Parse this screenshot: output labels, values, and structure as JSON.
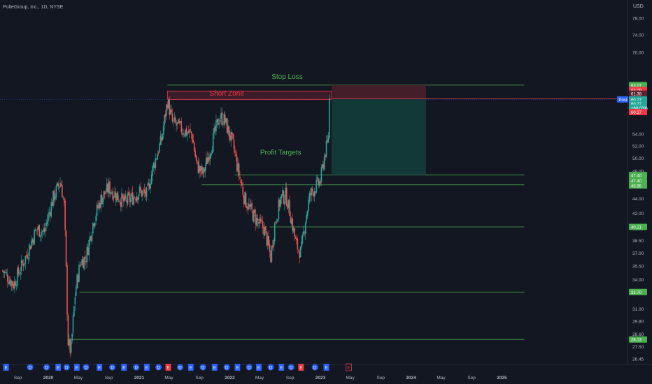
{
  "header": {
    "title": "PulteGroup, Inc., 1D, NYSE",
    "currency": "USD"
  },
  "colors": {
    "background": "#131722",
    "up": "#26a69a",
    "down": "#ef5350",
    "level_line": "#4caf50",
    "stop_line": "#4caf50",
    "short_zone_border": "#f23645",
    "short_zone_fill": "#5b2230",
    "target_fill": "#133a3a",
    "risk_fill": "#4a1f2a",
    "axis_text": "#b2b5be",
    "earnings_blue": "#2962ff",
    "earnings_red": "#f23645"
  },
  "chart_data": {
    "type": "candlestick",
    "title": "PulteGroup, Inc., 1D, NYSE",
    "y_axis": {
      "unit": "USD",
      "scale": "log",
      "ticks": [
        26.45,
        27.5,
        28.6,
        29.8,
        31.0,
        32.7,
        34.0,
        35.5,
        37.0,
        38.5,
        40.0,
        42.0,
        44.0,
        46.0,
        48.0,
        50.0,
        52.0,
        54.0,
        56.0,
        70.0,
        74.0,
        78.0
      ],
      "tick_labels": [
        "26.45",
        "27.50",
        "28.60",
        "29.80",
        "31.00",
        "",
        "34.00",
        "35.50",
        "37.00",
        "38.50",
        "40.00",
        "42.00",
        "44.00",
        "",
        "48.00",
        "50.00",
        "52.00",
        "54.00",
        "",
        "70.00",
        "74.00",
        "78.00"
      ]
    },
    "x_axis": {
      "tick_labels": [
        "Sep",
        "2020",
        "May",
        "Sep",
        "2021",
        "May",
        "Sep",
        "2022",
        "May",
        "Sep",
        "2023",
        "May",
        "Sep",
        "2024",
        "May",
        "Sep",
        "2025"
      ],
      "tick_dates": [
        "2019-09-01",
        "2020-01-01",
        "2020-05-01",
        "2020-09-01",
        "2021-01-01",
        "2021-05-01",
        "2021-09-01",
        "2022-01-01",
        "2022-05-01",
        "2022-09-01",
        "2023-01-01",
        "2023-05-01",
        "2023-09-01",
        "2024-01-01",
        "2024-05-01",
        "2024-09-01",
        "2025-01-01"
      ]
    },
    "price_path": [
      [
        "2019-07-01",
        35.0
      ],
      [
        "2019-08-15",
        33.5
      ],
      [
        "2019-10-01",
        36.5
      ],
      [
        "2019-11-15",
        40.0
      ],
      [
        "2019-12-15",
        39.5
      ],
      [
        "2020-01-20",
        44.0
      ],
      [
        "2020-02-20",
        46.5
      ],
      [
        "2020-03-05",
        43.0
      ],
      [
        "2020-03-20",
        28.0
      ],
      [
        "2020-04-01",
        27.0
      ],
      [
        "2020-04-20",
        33.0
      ],
      [
        "2020-05-10",
        36.0
      ],
      [
        "2020-06-01",
        36.5
      ],
      [
        "2020-07-01",
        41.0
      ],
      [
        "2020-08-01",
        44.0
      ],
      [
        "2020-09-01",
        45.5
      ],
      [
        "2020-10-01",
        44.5
      ],
      [
        "2020-11-01",
        43.5
      ],
      [
        "2020-12-01",
        44.0
      ],
      [
        "2021-01-01",
        45.0
      ],
      [
        "2021-02-01",
        44.5
      ],
      [
        "2021-03-01",
        49.0
      ],
      [
        "2021-04-01",
        53.0
      ],
      [
        "2021-04-25",
        60.0
      ],
      [
        "2021-05-15",
        56.0
      ],
      [
        "2021-06-01",
        55.5
      ],
      [
        "2021-07-01",
        54.5
      ],
      [
        "2021-08-01",
        54.0
      ],
      [
        "2021-08-20",
        49.0
      ],
      [
        "2021-09-15",
        47.5
      ],
      [
        "2021-10-15",
        51.5
      ],
      [
        "2021-11-20",
        57.0
      ],
      [
        "2021-12-10",
        56.5
      ],
      [
        "2022-01-15",
        52.0
      ],
      [
        "2022-02-01",
        48.5
      ],
      [
        "2022-03-01",
        44.0
      ],
      [
        "2022-04-01",
        42.0
      ],
      [
        "2022-05-01",
        40.5
      ],
      [
        "2022-05-20",
        40.0
      ],
      [
        "2022-06-15",
        36.5
      ],
      [
        "2022-07-01",
        40.5
      ],
      [
        "2022-07-25",
        44.0
      ],
      [
        "2022-08-15",
        44.5
      ],
      [
        "2022-09-01",
        42.0
      ],
      [
        "2022-09-25",
        38.0
      ],
      [
        "2022-10-15",
        37.0
      ],
      [
        "2022-11-01",
        41.0
      ],
      [
        "2022-11-20",
        44.5
      ],
      [
        "2022-12-10",
        45.5
      ],
      [
        "2023-01-01",
        46.5
      ],
      [
        "2023-01-20",
        51.0
      ],
      [
        "2023-02-01",
        52.5
      ],
      [
        "2023-02-06",
        60.27
      ]
    ],
    "last_price": 60.27,
    "price_labels": [
      {
        "text": "63.07",
        "value": 63.07,
        "type": "stop"
      },
      {
        "text": "63.09",
        "value": 62.1,
        "type": "risk"
      },
      {
        "text": "61.38",
        "value": 61.38,
        "type": "risk-dark"
      },
      {
        "text": "60.27",
        "value": 60.27,
        "type": "last"
      },
      {
        "text": "60.27",
        "value": 59.45,
        "type": "target-top"
      },
      {
        "text": "+68.03%",
        "value": 58.7,
        "type": "change"
      },
      {
        "text": "60.37",
        "value": 57.9,
        "type": "down"
      },
      {
        "text": "47.40",
        "value": 47.4,
        "type": "level"
      },
      {
        "text": "47.40",
        "value": 46.55,
        "type": "level"
      },
      {
        "text": "45.95",
        "value": 45.85,
        "type": "level"
      },
      {
        "text": "40.21",
        "value": 40.21,
        "type": "level"
      },
      {
        "text": "32.70",
        "value": 32.7,
        "type": "level"
      },
      {
        "text": "28.13",
        "value": 28.13,
        "type": "level"
      }
    ],
    "post_label": "Post",
    "horizontal_levels": [
      {
        "value": 63.07,
        "from": "2021-04-25",
        "to": "2025-04-01",
        "label": "Stop Loss"
      },
      {
        "value": 47.4,
        "from": "2022-01-20",
        "to": "2025-04-01"
      },
      {
        "value": 45.95,
        "from": "2021-09-10",
        "to": "2025-04-01"
      },
      {
        "value": 40.21,
        "from": "2022-06-10",
        "to": "2025-04-01"
      },
      {
        "value": 32.7,
        "from": "2020-05-05",
        "to": "2025-04-01"
      },
      {
        "value": 28.13,
        "from": "2020-04-01",
        "to": "2025-04-01"
      }
    ],
    "annotations": [
      {
        "text": "Stop Loss",
        "date": "2022-08-20",
        "value": 64.3,
        "color": "#4caf50"
      },
      {
        "text": "Short Zone",
        "date": "2021-12-20",
        "value": 61.0,
        "color": "#f23645"
      },
      {
        "text": "Profit Targets",
        "date": "2022-07-25",
        "value": 50.6,
        "color": "#4caf50"
      }
    ],
    "short_zone": {
      "from": "2021-04-25",
      "to": "2023-02-15",
      "low": 60.27,
      "high": 61.9
    },
    "position": {
      "from": "2023-02-15",
      "to": "2024-03-01",
      "entry": 60.37,
      "stop": 63.07,
      "target": 47.4
    },
    "earnings_markers": [
      {
        "date": "2019-07-15",
        "kind": "E",
        "color": "blue"
      },
      {
        "date": "2019-10-20",
        "kind": "D",
        "color": "blue"
      },
      {
        "date": "2019-12-25",
        "kind": "D",
        "color": "blue"
      },
      {
        "date": "2020-02-10",
        "kind": "E",
        "color": "blue"
      },
      {
        "date": "2020-03-15",
        "kind": "D",
        "color": "blue"
      },
      {
        "date": "2020-04-25",
        "kind": "E",
        "color": "blue"
      },
      {
        "date": "2020-06-01",
        "kind": "D",
        "color": "blue"
      },
      {
        "date": "2020-07-25",
        "kind": "E",
        "color": "blue"
      },
      {
        "date": "2020-09-15",
        "kind": "D",
        "color": "blue"
      },
      {
        "date": "2020-11-01",
        "kind": "E",
        "color": "blue"
      },
      {
        "date": "2020-12-20",
        "kind": "D",
        "color": "blue"
      },
      {
        "date": "2021-02-01",
        "kind": "E",
        "color": "blue"
      },
      {
        "date": "2021-03-20",
        "kind": "D",
        "color": "blue"
      },
      {
        "date": "2021-04-28",
        "kind": "E",
        "color": "red"
      },
      {
        "date": "2021-06-15",
        "kind": "D",
        "color": "blue"
      },
      {
        "date": "2021-07-28",
        "kind": "E",
        "color": "blue"
      },
      {
        "date": "2021-09-15",
        "kind": "D",
        "color": "blue"
      },
      {
        "date": "2021-11-01",
        "kind": "E",
        "color": "blue"
      },
      {
        "date": "2021-12-20",
        "kind": "D",
        "color": "blue"
      },
      {
        "date": "2022-02-01",
        "kind": "E",
        "color": "blue"
      },
      {
        "date": "2022-03-20",
        "kind": "D",
        "color": "blue"
      },
      {
        "date": "2022-04-28",
        "kind": "E",
        "color": "blue"
      },
      {
        "date": "2022-06-15",
        "kind": "D",
        "color": "blue"
      },
      {
        "date": "2022-07-28",
        "kind": "E",
        "color": "blue"
      },
      {
        "date": "2022-09-05",
        "kind": "D",
        "color": "blue"
      },
      {
        "date": "2022-10-15",
        "kind": "E",
        "color": "red"
      },
      {
        "date": "2022-12-10",
        "kind": "D",
        "color": "blue"
      },
      {
        "date": "2023-01-25",
        "kind": "E",
        "color": "blue"
      },
      {
        "date": "2023-04-25",
        "kind": "E",
        "color": "red-box"
      }
    ]
  }
}
